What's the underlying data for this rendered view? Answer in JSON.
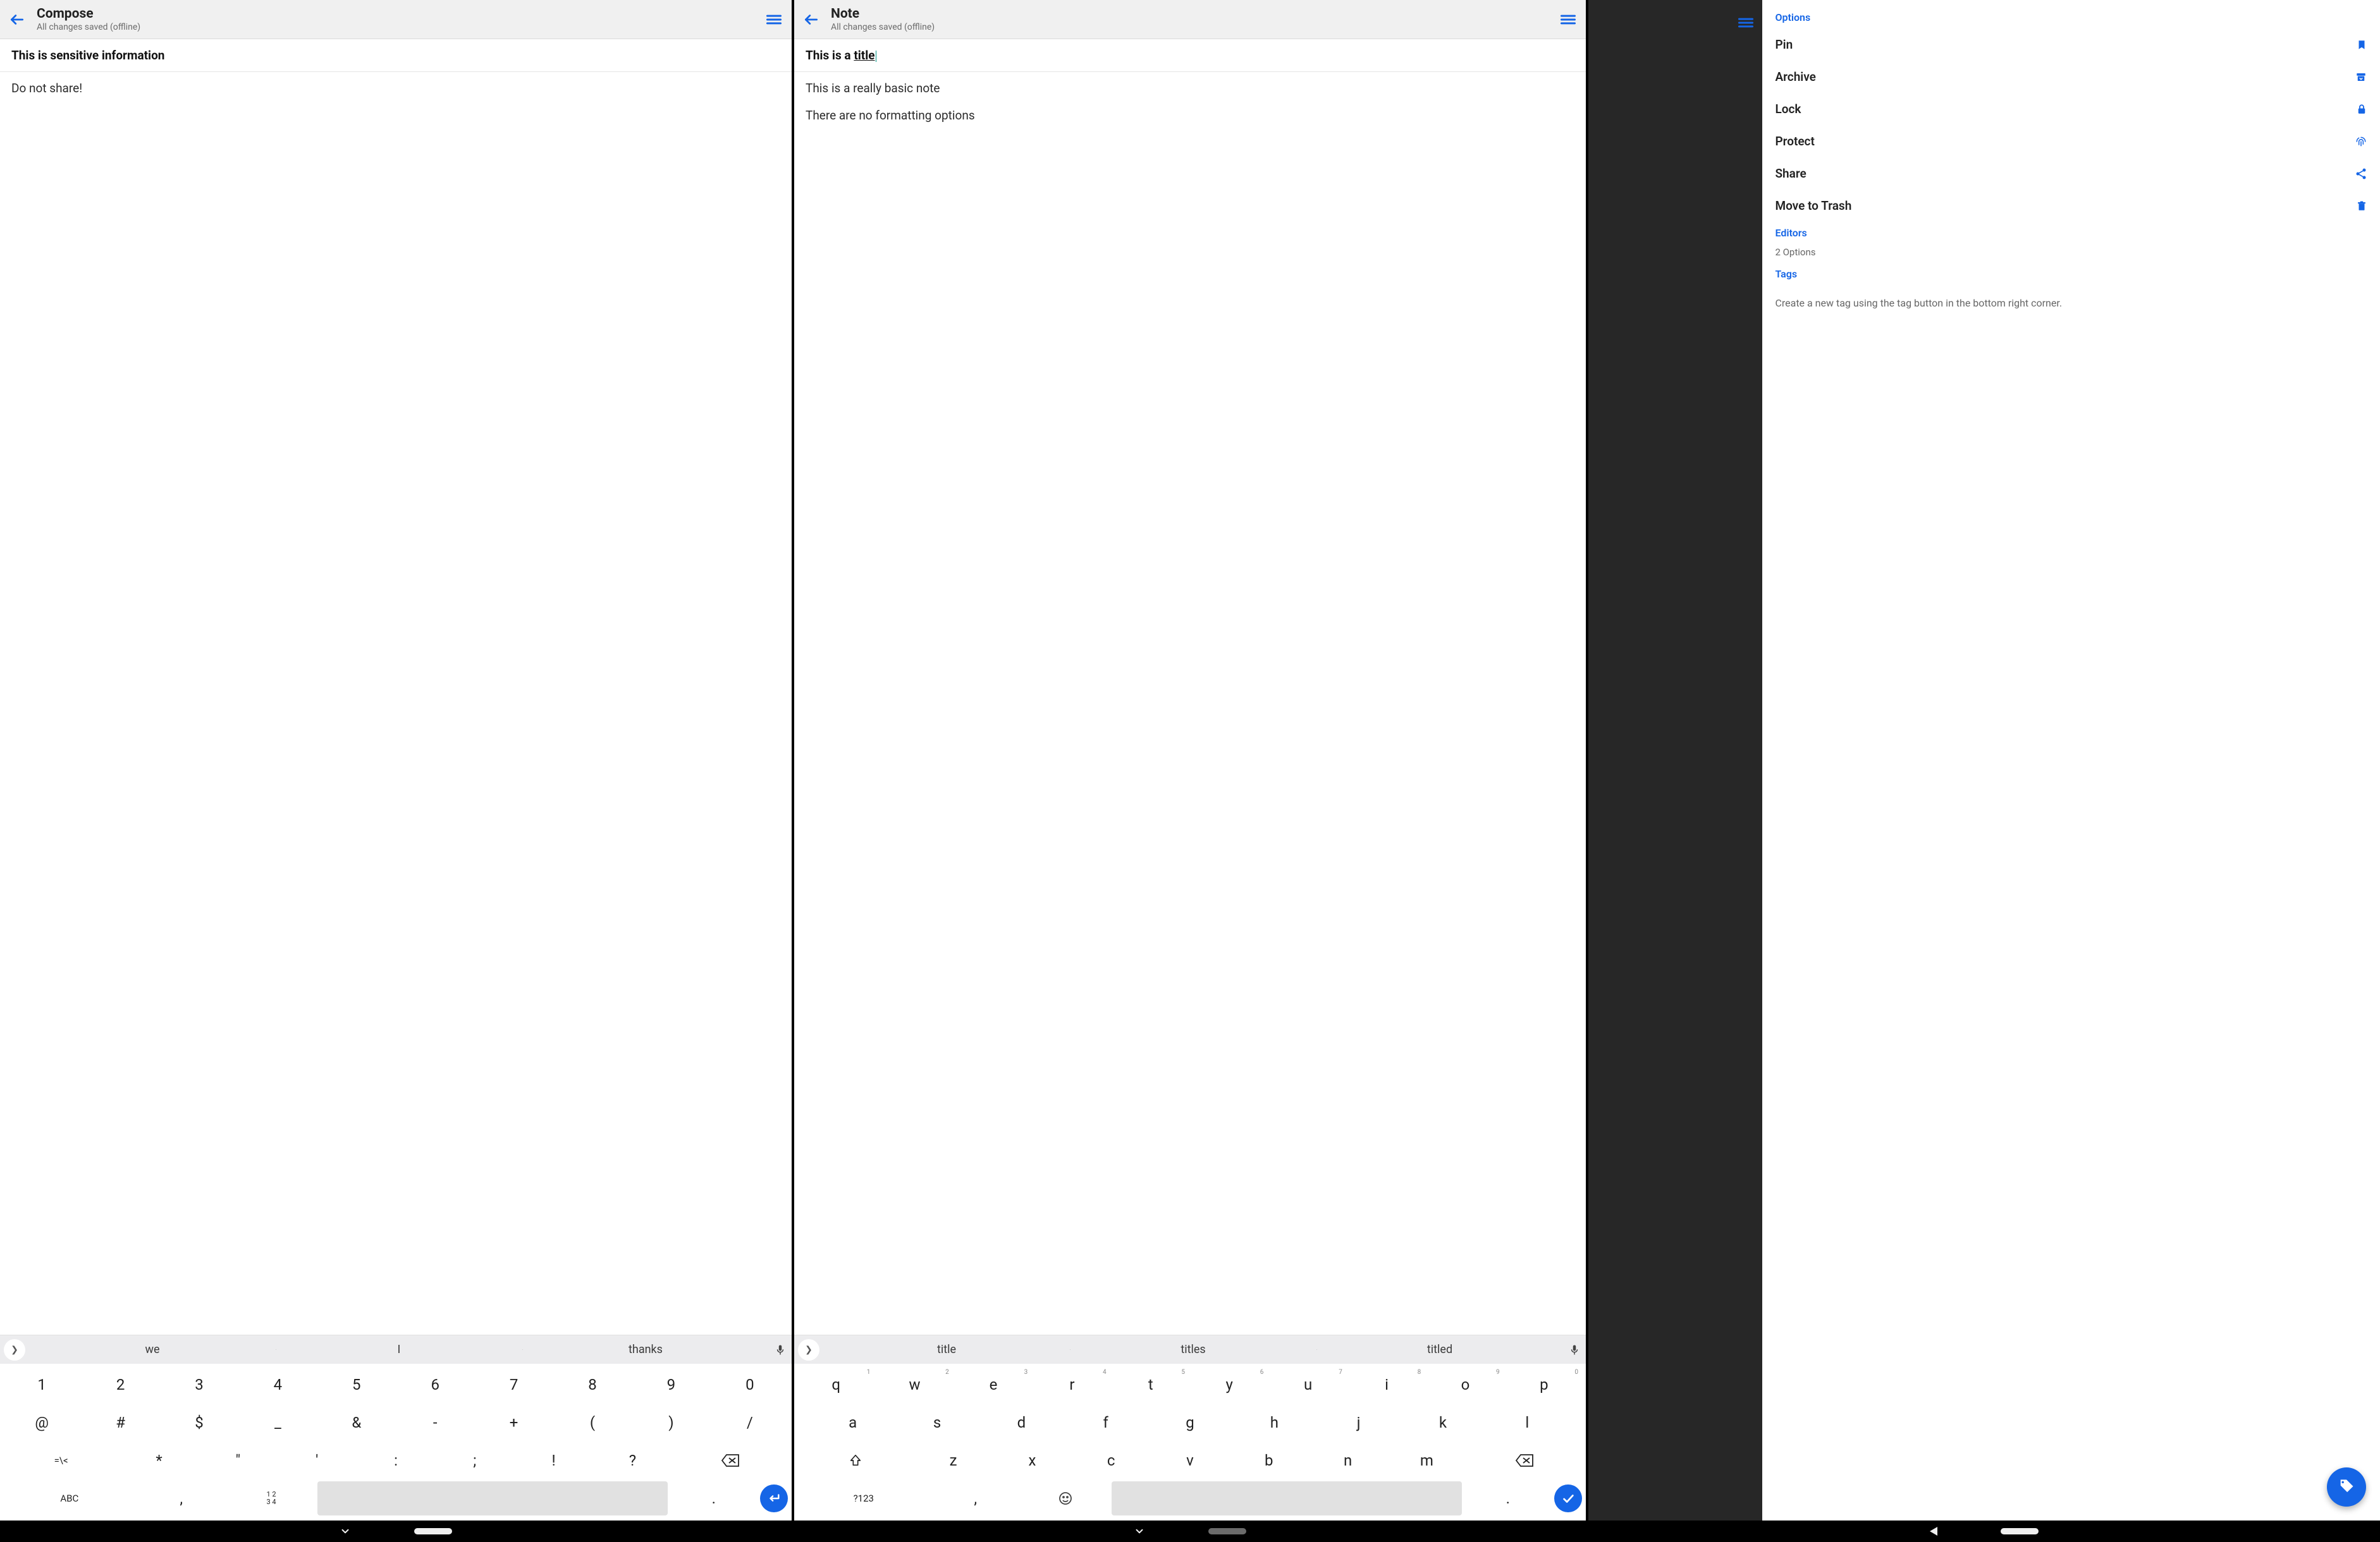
{
  "screen1": {
    "header": {
      "title": "Compose",
      "subtitle": "All changes saved (offline)"
    },
    "note_title": "This is sensitive information",
    "body_lines": [
      "Do not share!"
    ],
    "suggestions": [
      "we",
      "I",
      "thanks"
    ],
    "keyboard": {
      "row1": [
        "1",
        "2",
        "3",
        "4",
        "5",
        "6",
        "7",
        "8",
        "9",
        "0"
      ],
      "row2": [
        "@",
        "#",
        "$",
        "_",
        "&",
        "-",
        "+",
        "(",
        ")",
        "/"
      ],
      "row3_sym": "=\\<",
      "row3": [
        "*",
        "\"",
        "'",
        ":",
        ";",
        "!",
        "?"
      ],
      "bottom_mode": "ABC",
      "bottom_numpad": "1 2\n3 4",
      "comma": ",",
      "period": "."
    }
  },
  "screen2": {
    "header": {
      "title": "Note",
      "subtitle": "All changes saved (offline)"
    },
    "note_title_prefix": "This is a ",
    "note_title_underlined": "title",
    "body_lines": [
      "This is a really basic note",
      "There are no formatting options"
    ],
    "suggestions": [
      "title",
      "titles",
      "titled"
    ],
    "keyboard": {
      "row1": [
        {
          "k": "q",
          "s": "1"
        },
        {
          "k": "w",
          "s": "2"
        },
        {
          "k": "e",
          "s": "3"
        },
        {
          "k": "r",
          "s": "4"
        },
        {
          "k": "t",
          "s": "5"
        },
        {
          "k": "y",
          "s": "6"
        },
        {
          "k": "u",
          "s": "7"
        },
        {
          "k": "i",
          "s": "8"
        },
        {
          "k": "o",
          "s": "9"
        },
        {
          "k": "p",
          "s": "0"
        }
      ],
      "row2": [
        "a",
        "s",
        "d",
        "f",
        "g",
        "h",
        "j",
        "k",
        "l"
      ],
      "row3": [
        "z",
        "x",
        "c",
        "v",
        "b",
        "n",
        "m"
      ],
      "bottom_mode": "?123",
      "comma": ",",
      "period": "."
    }
  },
  "screen3": {
    "sections": {
      "options_label": "Options",
      "items": [
        {
          "label": "Pin",
          "icon": "bookmark"
        },
        {
          "label": "Archive",
          "icon": "archive"
        },
        {
          "label": "Lock",
          "icon": "lock"
        },
        {
          "label": "Protect",
          "icon": "fingerprint"
        },
        {
          "label": "Share",
          "icon": "share"
        },
        {
          "label": "Move to Trash",
          "icon": "trash"
        }
      ],
      "editors_label": "Editors",
      "editors_sub": "2 Options",
      "tags_label": "Tags",
      "tags_text": "Create a new tag using the tag button in the bottom right corner."
    }
  }
}
